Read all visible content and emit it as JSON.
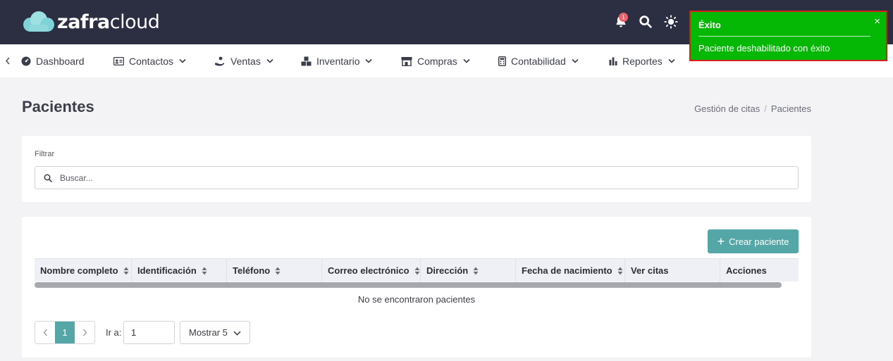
{
  "app": {
    "logo_bold": "zafra",
    "logo_light": "cloud",
    "notification_count": "1"
  },
  "nav": {
    "items": [
      {
        "label": "Dashboard"
      },
      {
        "label": "Contactos"
      },
      {
        "label": "Ventas"
      },
      {
        "label": "Inventario"
      },
      {
        "label": "Compras"
      },
      {
        "label": "Contabilidad"
      },
      {
        "label": "Reportes"
      }
    ]
  },
  "page": {
    "title": "Pacientes",
    "breadcrumb": [
      "Gestión de citas",
      "Pacientes"
    ]
  },
  "filter": {
    "label": "Filtrar",
    "search_placeholder": "Buscar..."
  },
  "table": {
    "create_label": "Crear paciente",
    "columns": [
      {
        "label": "Nombre completo",
        "sortable": true
      },
      {
        "label": "Identificación",
        "sortable": true
      },
      {
        "label": "Teléfono",
        "sortable": true
      },
      {
        "label": "Correo electrónico",
        "sortable": true
      },
      {
        "label": "Dirección",
        "sortable": true
      },
      {
        "label": "Fecha de nacimiento",
        "sortable": true
      },
      {
        "label": "Ver citas",
        "sortable": false
      },
      {
        "label": "Acciones",
        "sortable": false
      }
    ],
    "empty_message": "No se encontraron pacientes"
  },
  "pagination": {
    "current_page": "1",
    "goto_label": "Ir a:",
    "goto_value": "1",
    "page_size_label": "Mostrar 5"
  },
  "toast": {
    "title": "Éxito",
    "message": "Paciente deshabilitado con éxito",
    "close_symbol": "×"
  },
  "colors": {
    "topbar": "#2c2f42",
    "accent": "#55a6a6",
    "toast_success": "#06b806",
    "toast_border": "#d42020"
  }
}
